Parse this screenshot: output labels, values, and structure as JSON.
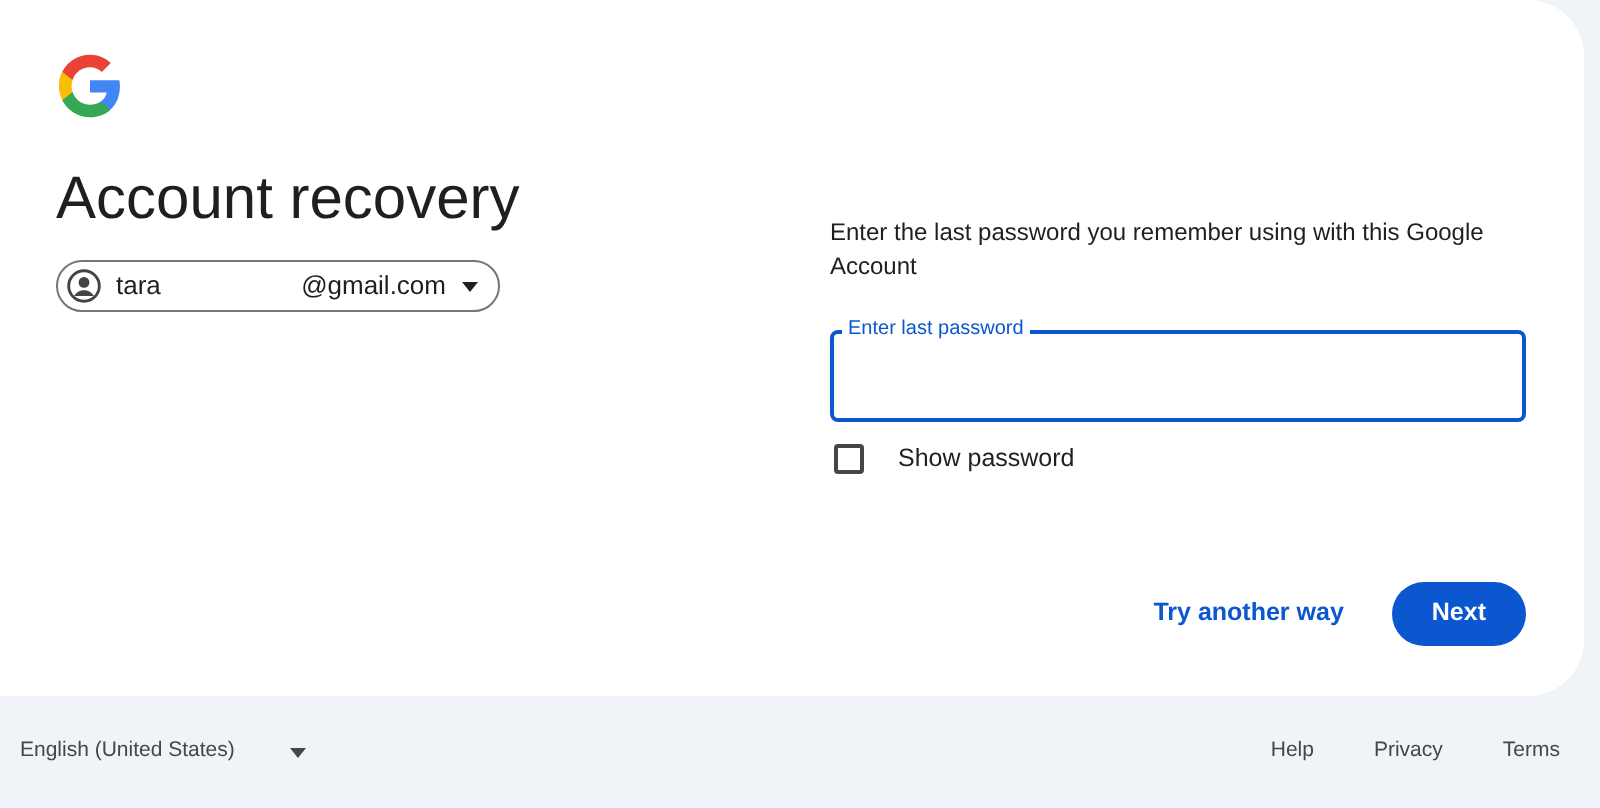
{
  "card": {
    "title": "Account recovery",
    "account": {
      "name_start": "tara",
      "domain": "@gmail.com"
    },
    "instructions": "Enter the last password you remember using with this Google Account",
    "password_field": {
      "label": "Enter last password",
      "focused": true
    },
    "show_password": {
      "label": "Show password",
      "checked": false
    },
    "buttons": [
      {
        "kind": "text",
        "label": "Try another way"
      },
      {
        "kind": "filled",
        "label": "Next"
      }
    ]
  },
  "footer": {
    "language": "English (United States)",
    "links": [
      "Help",
      "Privacy",
      "Terms"
    ]
  }
}
